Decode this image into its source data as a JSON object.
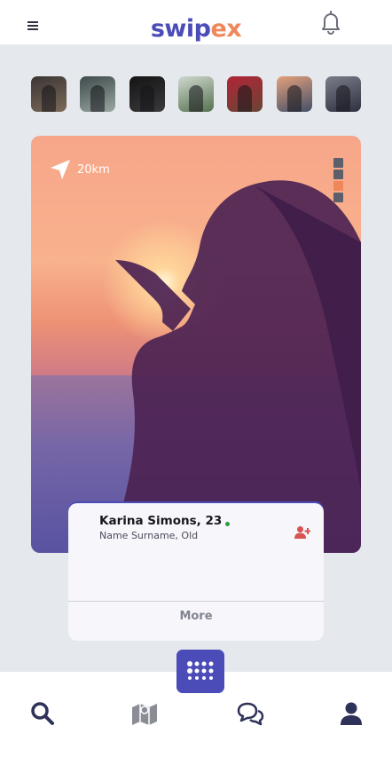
{
  "app": {
    "logo_part1": "swip",
    "logo_part2": "ex"
  },
  "header": {
    "menu_icon": "hamburger-icon",
    "notification_icon": "bell-icon"
  },
  "stories": [
    {
      "name": "story-1",
      "colors": [
        "#3a3533",
        "#7d6a5a"
      ]
    },
    {
      "name": "story-2",
      "colors": [
        "#3d4a4a",
        "#9aa7a2"
      ]
    },
    {
      "name": "story-3",
      "colors": [
        "#141414",
        "#3a3a3a"
      ]
    },
    {
      "name": "story-4",
      "colors": [
        "#cfd8cf",
        "#56714f"
      ]
    },
    {
      "name": "story-5",
      "colors": [
        "#b02538",
        "#6a4535"
      ]
    },
    {
      "name": "story-6",
      "colors": [
        "#e3a07a",
        "#43506a"
      ]
    },
    {
      "name": "story-7",
      "colors": [
        "#7c7d89",
        "#2f3040"
      ]
    }
  ],
  "profile_card": {
    "distance": "20km",
    "photo_index": 3,
    "photo_total": 4,
    "name_age": "Karina Simons, 23",
    "subtitle": "Name Surname, Old",
    "status": "online",
    "more_label": "More"
  },
  "colors": {
    "accent": "#4b4cb8",
    "brand_orange": "#f0875b",
    "online": "#2a9d3a",
    "add_user": "#d9534f"
  },
  "bottom_nav": [
    "search-icon",
    "map-icon",
    "chat-icon",
    "profile-icon"
  ],
  "fab_icon": "dots-grid-icon"
}
